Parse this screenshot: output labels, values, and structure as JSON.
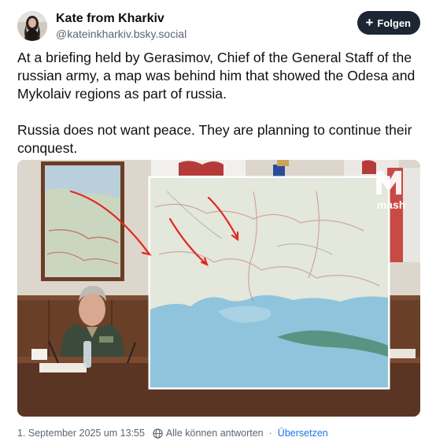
{
  "author": {
    "display_name": "Kate from Kharkiv",
    "handle": "@kateinkharkiv.bsky.social"
  },
  "follow_button": {
    "label": "Folgen",
    "icon": "plus-icon"
  },
  "post": {
    "paragraphs": [
      "At a briefing held by Gerasimov, Chief of the General Staff of the russian army, a map was behind  him that showed the Odesa and Mykolaiv regions as part of russia.",
      "Russia does not want peace. They are planning to continue their conquest."
    ]
  },
  "media": {
    "watermark": "mash"
  },
  "footer": {
    "timestamp": "1. September 2025 um 13:55",
    "reply_setting": "Alle können antworten",
    "separator": "·",
    "translate_label": "Übersetzen"
  },
  "colors": {
    "follow_bg": "#1c2733",
    "link": "#1a73e8",
    "secondary_text": "#5b6672"
  }
}
